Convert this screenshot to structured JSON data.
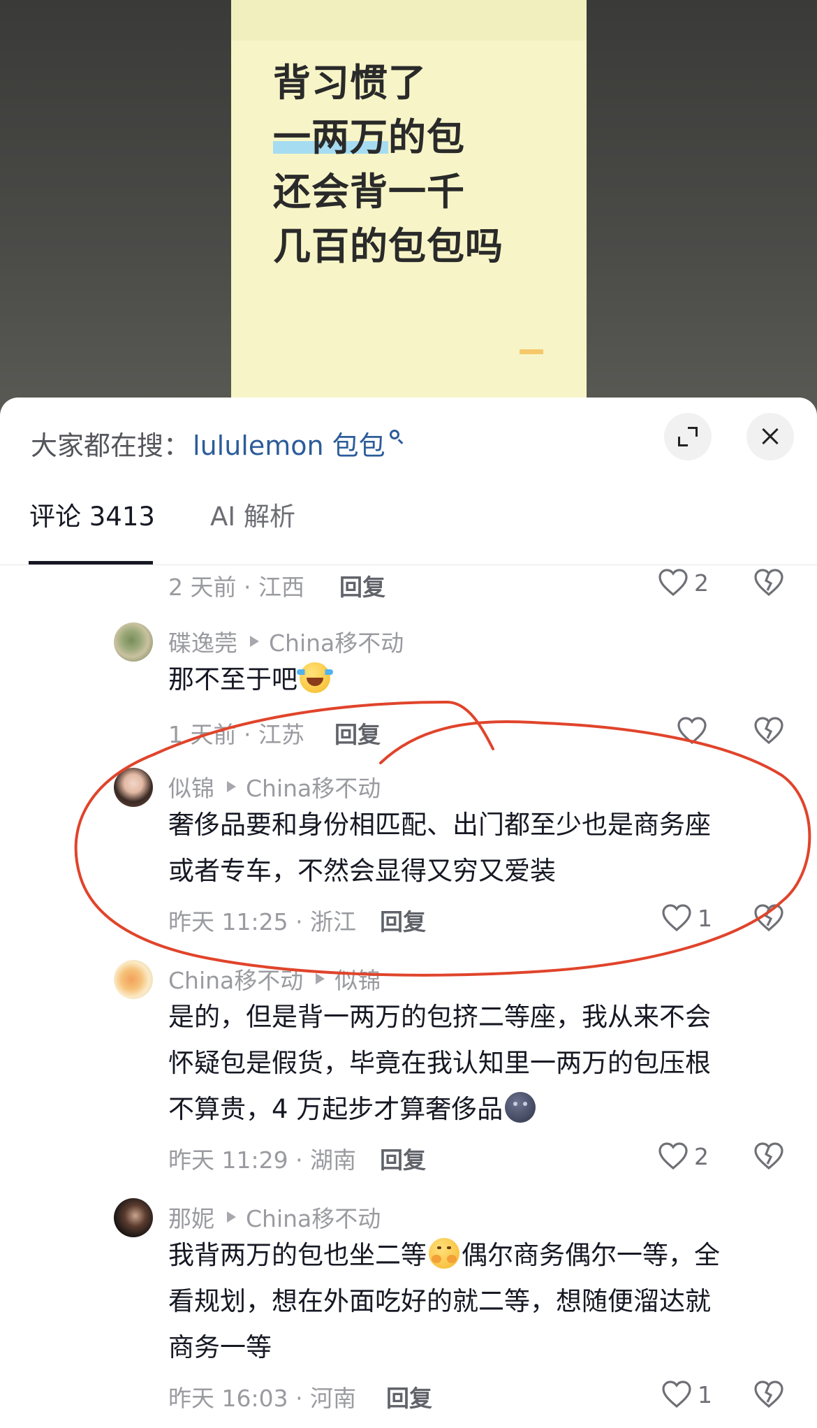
{
  "video": {
    "lines": [
      "背习惯了",
      "一两万的包",
      "还会背一千",
      "几百的包包吗"
    ]
  },
  "search": {
    "prefix": "大家都在搜：",
    "term": "lululemon 包包"
  },
  "tabs": [
    {
      "label": "评论 3413",
      "active": true
    },
    {
      "label": "AI 解析",
      "active": false
    }
  ],
  "reply_label": "回复",
  "comments": [
    {
      "time_location": "2 天前 · 江西",
      "likes": "2"
    },
    {
      "user": "碟逸莞",
      "reply_to": "China移不动",
      "text_lines": [
        "那不至于吧"
      ],
      "emoji": "face-with-tears-of-joy",
      "time_location": "1 天前 · 江苏",
      "likes": ""
    },
    {
      "user": "似锦",
      "reply_to": "China移不动",
      "text_lines": [
        "奢侈品要和身份相匹配、出门都至少也是商务座",
        "或者专车，不然会显得又穷又爱装"
      ],
      "time_location": "昨天 11:25 · 浙江",
      "likes": "1",
      "highlighted": true
    },
    {
      "user": "China移不动",
      "reply_to": "似锦",
      "text_lines": [
        "是的，但是背一两万的包挤二等座，我从来不会",
        "怀疑包是假货，毕竟在我认知里一两万的包压根",
        "不算贵，4 万起步才算奢侈品"
      ],
      "emoji": "new-moon-face",
      "time_location": "昨天 11:29 · 湖南",
      "likes": "2"
    },
    {
      "user": "那妮",
      "reply_to": "China移不动",
      "text_lines": [
        "我背两万的包也坐二等",
        "偶尔商务偶尔一等，全",
        "看规划，想在外面吃好的就二等，想随便溜达就",
        "商务一等"
      ],
      "emoji": "hugging-face",
      "time_location": "昨天 16:03 · 河南",
      "likes": "1"
    }
  ],
  "colors": {
    "annotation": "#e0442b",
    "link": "#2c5c9a",
    "video_bg": "#f7f5c7",
    "highlight": "#a6dcf2"
  }
}
